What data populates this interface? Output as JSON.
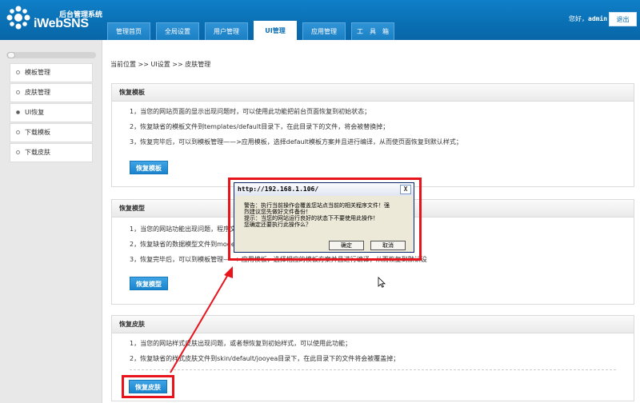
{
  "header": {
    "logo_subtitle": "后台管理系统",
    "logo_title": "iWebSNS",
    "tabs": [
      {
        "label": "管理首页",
        "active": false
      },
      {
        "label": "全局设置",
        "active": false
      },
      {
        "label": "用户管理",
        "active": false
      },
      {
        "label": "UI管理",
        "active": true
      },
      {
        "label": "应用管理",
        "active": false
      },
      {
        "label": "工　具　箱",
        "active": false
      }
    ],
    "welcome_prefix": "您好，",
    "username": "admin",
    "logout_label": "退出"
  },
  "sidebar": {
    "items": [
      {
        "label": "模板管理",
        "active": false
      },
      {
        "label": "皮肤管理",
        "active": false
      },
      {
        "label": "UI恢复",
        "active": true
      },
      {
        "label": "下载模板",
        "active": false
      },
      {
        "label": "下载皮肤",
        "active": false
      }
    ]
  },
  "main": {
    "breadcrumb": "当前位置 >> UI设置 >> 皮肤管理",
    "panels": [
      {
        "title": "恢复模板",
        "lines": [
          "1，当您的网站页面的显示出现问题时，可以使用此功能把前台页面恢复到初始状态；",
          "2，恢复缺省的模板文件到templates/default目录下，在此目录下的文件，将会被替换掉；",
          "3，恢复完毕后，可以到模板管理——>应用模板，选择default模板方案并且进行编译，从而使页面恢复到默认样式；"
        ],
        "button": "恢复模板"
      },
      {
        "title": "恢复模型",
        "lines": [
          "1，当您的网站功能出现问题，程序文",
          "2，恢复缺省的数据模型文件到models",
          "3，恢复完毕后，可以到模板管理——>应用模板，选择相应的模板方案并且进行编译，从而恢复到默认设"
        ],
        "button": "恢复模型"
      },
      {
        "title": "恢复皮肤",
        "lines": [
          "1，当您的网站样式皮肤出现问题，或者想恢复到初始样式，可以使用此功能；",
          "2，恢复缺省的样式皮肤文件到skin/default/jooyea目录下，在此目录下的文件将会被覆盖掉；"
        ],
        "button": "恢复皮肤"
      }
    ]
  },
  "dialog": {
    "title": "http://192.168.1.106/",
    "close_glyph": "X",
    "message_lines": [
      "警告：执行当前操作会覆盖您站点当前的相关程序文件！强",
      "烈建议您先做好文件备份！",
      "提示：当您的网站运行良好的状态下不要使用此操作！",
      "您确定还要执行此操作么？"
    ],
    "ok_label": "确定",
    "cancel_label": "取消"
  },
  "annotation_color": "#e8141c"
}
